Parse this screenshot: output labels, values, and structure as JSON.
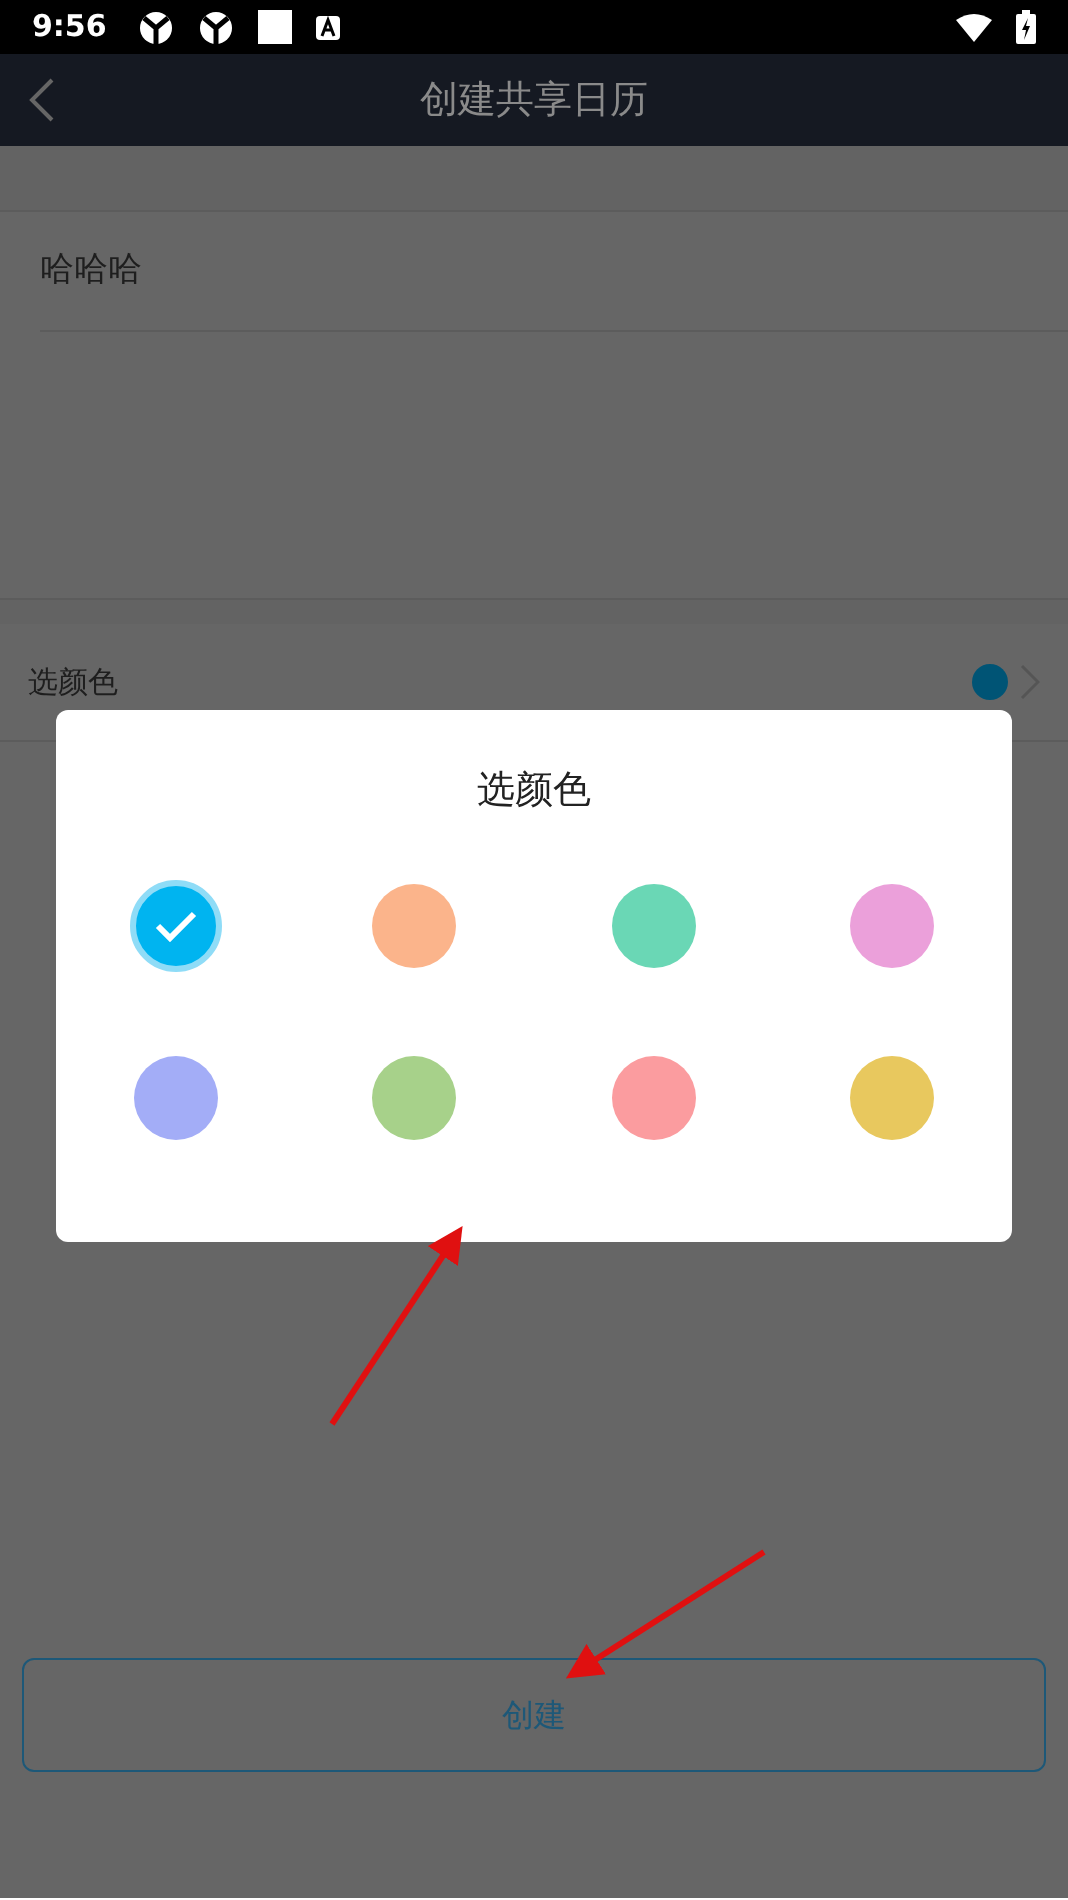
{
  "status_bar": {
    "time": "9:56"
  },
  "header": {
    "title": "创建共享日历"
  },
  "name_field": {
    "value": "哈哈哈"
  },
  "color_row": {
    "label": "选颜色",
    "color": "#005475"
  },
  "create_button": {
    "label": "创建"
  },
  "dialog": {
    "title": "选颜色",
    "colors": [
      {
        "color": "#00b4f0",
        "selected": true
      },
      {
        "color": "#fbb48b",
        "selected": false
      },
      {
        "color": "#6ad7b5",
        "selected": false
      },
      {
        "color": "#eba0da",
        "selected": false
      },
      {
        "color": "#a3adf7",
        "selected": false
      },
      {
        "color": "#a7d18a",
        "selected": false
      },
      {
        "color": "#fb9c9f",
        "selected": false
      },
      {
        "color": "#e8c85e",
        "selected": false
      }
    ]
  }
}
